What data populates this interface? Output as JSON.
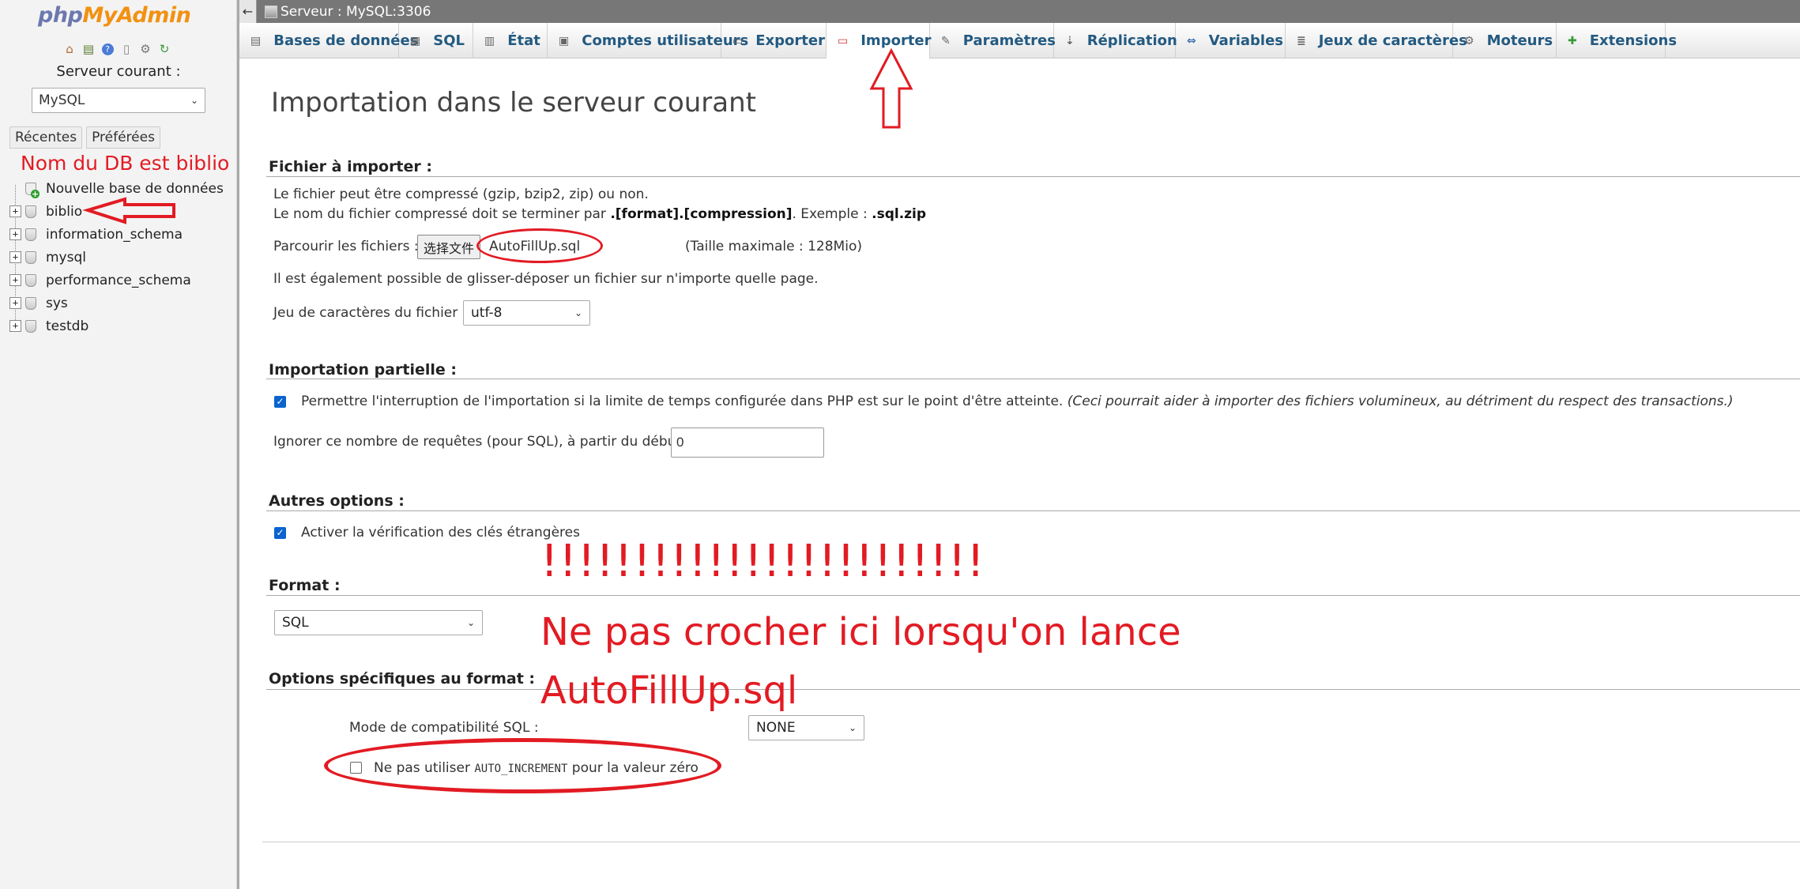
{
  "nav": {
    "logo_php": "php",
    "logo_myadmin": "MyAdmin",
    "icons": [
      "home-icon",
      "database-icon",
      "help-icon",
      "docs-icon",
      "settings-icon",
      "reload-icon"
    ],
    "server_label": "Serveur courant :",
    "server_value": "MySQL",
    "tab_recent": "Récentes",
    "tab_favorites": "Préférées",
    "new_db": "Nouvelle base de données",
    "databases": [
      "biblio",
      "information_schema",
      "mysql",
      "performance_schema",
      "sys",
      "testdb"
    ]
  },
  "topbar": {
    "back": "←",
    "server_title": "Serveur : MySQL:3306"
  },
  "menu": [
    {
      "label": "Bases de données",
      "icon": "database-icon"
    },
    {
      "label": "SQL",
      "icon": "sql-icon"
    },
    {
      "label": "État",
      "icon": "status-icon"
    },
    {
      "label": "Comptes utilisateurs",
      "icon": "users-icon"
    },
    {
      "label": "Exporter",
      "icon": "export-icon"
    },
    {
      "label": "Importer",
      "icon": "import-icon",
      "active": true
    },
    {
      "label": "Paramètres",
      "icon": "wrench-icon"
    },
    {
      "label": "Réplication",
      "icon": "replication-icon"
    },
    {
      "label": "Variables",
      "icon": "variables-icon"
    },
    {
      "label": "Jeux de caractères",
      "icon": "charset-icon"
    },
    {
      "label": "Moteurs",
      "icon": "engines-icon"
    },
    {
      "label": "Extensions",
      "icon": "puzzle-icon"
    }
  ],
  "page": {
    "title": "Importation dans le serveur courant",
    "file_section": {
      "title": "Fichier à importer :",
      "line1": "Le fichier peut être compressé (gzip, bzip2, zip) ou non.",
      "line2_a": "Le nom du fichier compressé doit se terminer par ",
      "line2_b": ".[format].[compression]",
      "line2_c": ". Exemple : ",
      "line2_d": ".sql.zip",
      "browse_label": "Parcourir les fichiers :",
      "file_button": "选择文件",
      "file_name": "AutoFillUp.sql",
      "max_size": "(Taille maximale : 128Mio)",
      "drag_note": "Il est également possible de glisser-déposer un fichier sur n'importe quelle page.",
      "charset_label": "Jeu de caractères du fichier :",
      "charset_value": "utf-8"
    },
    "partial_section": {
      "title": "Importation partielle :",
      "allow_interrupt": "Permettre l'interruption de l'importation si la limite de temps configurée dans PHP est sur le point d'être atteinte.",
      "allow_interrupt_note": "(Ceci pourrait aider à importer des fichiers volumineux, au détriment du respect des transactions.)",
      "allow_interrupt_checked": true,
      "skip_label": "Ignorer ce nombre de requêtes (pour SQL), à partir du début :",
      "skip_value": "0"
    },
    "other_section": {
      "title": "Autres options :",
      "fk_check": "Activer la vérification des clés étrangères",
      "fk_checked": true
    },
    "format_section": {
      "title": "Format :",
      "value": "SQL"
    },
    "format_options": {
      "title": "Options spécifiques au format :",
      "compat_label": "Mode de compatibilité SQL :",
      "compat_value": "NONE",
      "no_autoinc_a": "Ne pas utiliser ",
      "no_autoinc_code": "AUTO_INCREMENT",
      "no_autoinc_b": " pour la valeur zéro",
      "no_autoinc_checked": false
    }
  },
  "annotations": {
    "db_note": "Nom du DB est biblio",
    "exclaim": "!!!!!!!!!!!!!!!!!!!!!!!!",
    "warning_line1": "Ne pas crocher ici lorsqu'on lance",
    "warning_line2": "AutoFillUp.sql",
    "color": "#e21b23"
  },
  "colors": {
    "link": "#235a81",
    "logo_php": "#6c78af",
    "logo_myadmin": "#f29111",
    "checkbox": "#0b63ce"
  }
}
